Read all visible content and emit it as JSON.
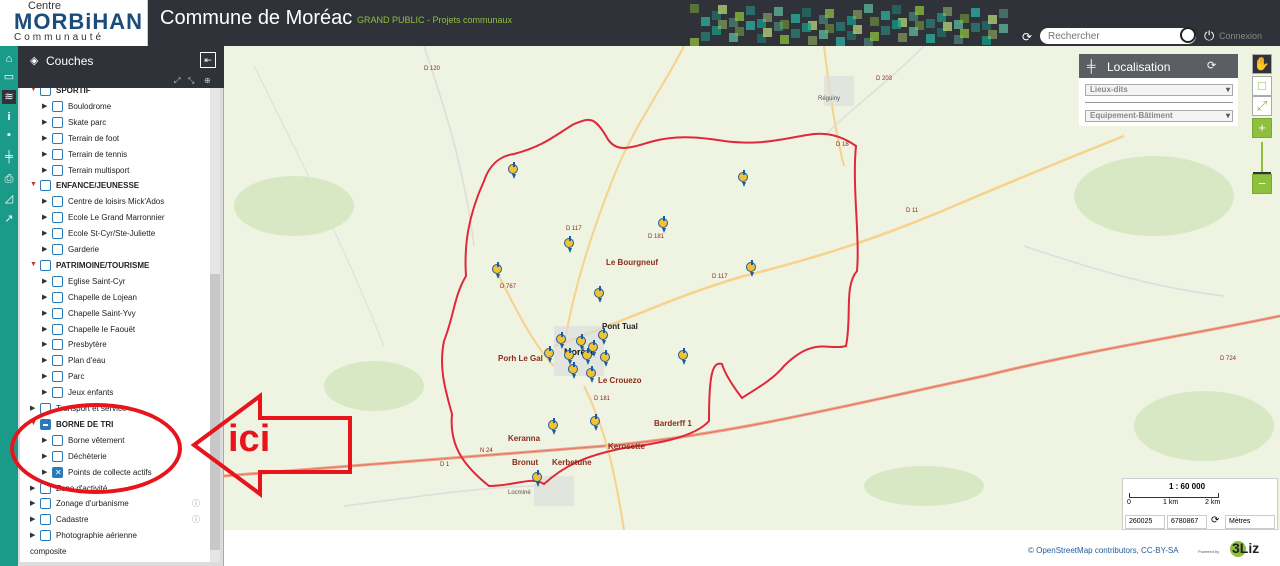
{
  "header": {
    "logo_line1": "Centre",
    "logo_line2": "MORBiHAN",
    "logo_line3": "Communauté",
    "title": "Commune de Moréac",
    "subtitle": "GRAND PUBLIC - Projets communaux",
    "search_placeholder": "Rechercher",
    "login": "Connexion"
  },
  "panel": {
    "title": "Couches",
    "items": [
      {
        "label": "SPORTIF",
        "level": 0,
        "group": true,
        "expanded": true,
        "checked": "none"
      },
      {
        "label": "Boulodrome",
        "level": 1,
        "checked": "none"
      },
      {
        "label": "Skate parc",
        "level": 1,
        "checked": "none"
      },
      {
        "label": "Terrain de foot",
        "level": 1,
        "checked": "none"
      },
      {
        "label": "Terrain de tennis",
        "level": 1,
        "checked": "none"
      },
      {
        "label": "Terrain multisport",
        "level": 1,
        "checked": "none"
      },
      {
        "label": "ENFANCE/JEUNESSE",
        "level": 0,
        "group": true,
        "expanded": true,
        "checked": "none"
      },
      {
        "label": "Centre de loisirs Mick'Ados",
        "level": 1,
        "checked": "none"
      },
      {
        "label": "Ecole Le Grand Marronnier",
        "level": 1,
        "checked": "none"
      },
      {
        "label": "Ecole St-Cyr/Ste-Juliette",
        "level": 1,
        "checked": "none"
      },
      {
        "label": "Garderie",
        "level": 1,
        "checked": "none"
      },
      {
        "label": "PATRIMOINE/TOURISME",
        "level": 0,
        "group": true,
        "expanded": true,
        "checked": "none"
      },
      {
        "label": "Eglise Saint-Cyr",
        "level": 1,
        "checked": "none"
      },
      {
        "label": "Chapelle de Lojean",
        "level": 1,
        "checked": "none"
      },
      {
        "label": "Chapelle Saint-Yvy",
        "level": 1,
        "checked": "none"
      },
      {
        "label": "Chapelle le Faouët",
        "level": 1,
        "checked": "none"
      },
      {
        "label": "Presbytère",
        "level": 1,
        "checked": "none"
      },
      {
        "label": "Plan d'eau",
        "level": 1,
        "checked": "none"
      },
      {
        "label": "Parc",
        "level": 1,
        "checked": "none"
      },
      {
        "label": "Jeux enfants",
        "level": 1,
        "checked": "none"
      },
      {
        "label": "Transport et service",
        "level": 0,
        "group": false,
        "expanded": false,
        "checked": "none"
      },
      {
        "label": "BORNE DE TRI",
        "level": 0,
        "group": true,
        "expanded": true,
        "checked": "partial"
      },
      {
        "label": "Borne vêtement",
        "level": 1,
        "checked": "none"
      },
      {
        "label": "Déchèterie",
        "level": 1,
        "checked": "none"
      },
      {
        "label": "Points de collecte actifs",
        "level": 1,
        "checked": "checked"
      },
      {
        "label": "Zone d'activité",
        "level": 0,
        "group": false,
        "expanded": false,
        "checked": "none"
      },
      {
        "label": "Zonage d'urbanisme",
        "level": 0,
        "group": false,
        "expanded": false,
        "checked": "none",
        "info": true
      },
      {
        "label": "Cadastre",
        "level": 0,
        "group": false,
        "expanded": false,
        "checked": "none",
        "info": true
      },
      {
        "label": "Photographie aérienne",
        "level": 0,
        "group": false,
        "expanded": false,
        "checked": "none"
      },
      {
        "label": "composite",
        "level": 0,
        "group": false,
        "expanded": false,
        "checked": "none",
        "continuation": true
      }
    ]
  },
  "annotation": {
    "text": "ici",
    "color": "#e8141b"
  },
  "localisation": {
    "title": "Localisation",
    "select1": "Lieux-dits",
    "select2": "Equipement-Bâtiment"
  },
  "map": {
    "places": [
      "Le Bourgneuf",
      "Pont Tual",
      "Moréac",
      "Porh Le Gal",
      "Le Crouezo",
      "Barderff 1",
      "Keranna",
      "Kerosette",
      "Bronut",
      "Kerbetune",
      "Réguiny",
      "Locminé"
    ],
    "roads": [
      "D 117",
      "D 181",
      "D 767",
      "D 181",
      "N 24",
      "D 117",
      "D 11",
      "D 18",
      "D 724",
      "D 203",
      "D 1",
      "D 120"
    ]
  },
  "scale": {
    "ratio": "1 : 60 000",
    "l0": "0",
    "l1": "1 km",
    "l2": "2 km",
    "x": "260025",
    "y": "6780867",
    "units": "Mètres"
  },
  "footer": {
    "attribution": "© OpenStreetMap contributors, CC-BY-SA",
    "powered": "Powered by",
    "brand": "3Liz"
  },
  "colors": {
    "teal": "#1a9b8a",
    "header": "#2f3238",
    "green": "#8fbf3f",
    "boundary": "#e0283a"
  }
}
